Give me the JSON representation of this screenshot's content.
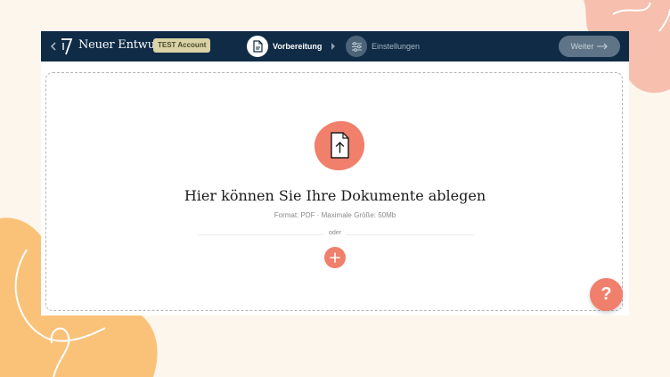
{
  "header": {
    "title": "Neuer Entwurf",
    "badge": "TEST Account",
    "steps": [
      {
        "label": "Vorbereitung",
        "icon": "document-icon",
        "active": true
      },
      {
        "label": "Einstellungen",
        "icon": "sliders-icon",
        "active": false
      }
    ],
    "next_label": "Weiter"
  },
  "dropzone": {
    "title": "Hier können Sie Ihre Dokumente ablegen",
    "subtitle": "Format: PDF · Maximale Größe: 50Mb",
    "divider_text": "oder"
  },
  "help": {
    "label": "?"
  },
  "colors": {
    "header_bg": "#0f2b46",
    "accent": "#f07f6b",
    "badge_bg": "#d9d3a5",
    "page_bg": "#fdf6ec",
    "blob_peach": "#f6bfae",
    "blob_yellow": "#fac279"
  }
}
